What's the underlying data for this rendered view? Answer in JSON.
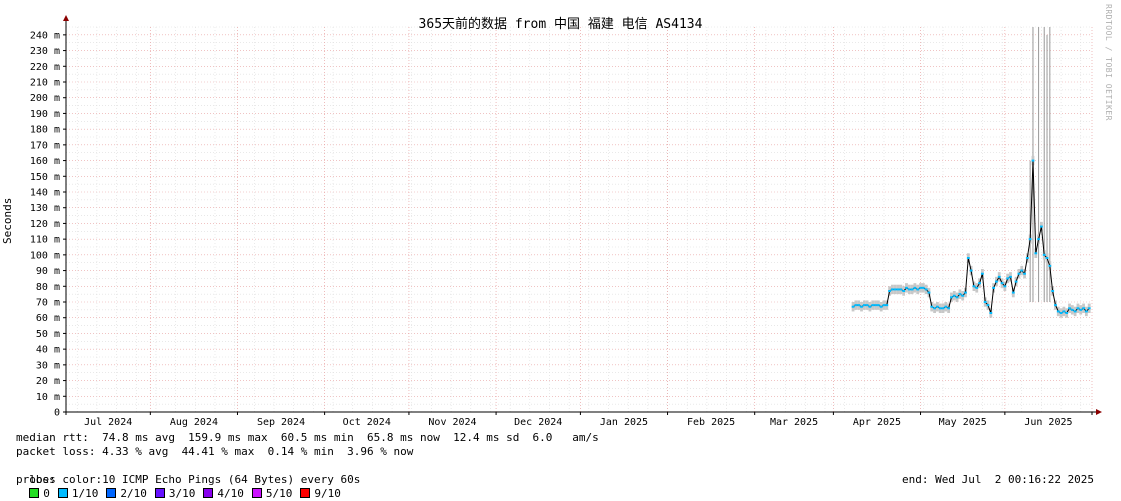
{
  "chart_data": {
    "type": "line",
    "title": "365天前的数据 from 中国 福建 电信 AS4134",
    "ylabel": "Seconds",
    "watermark": "RRDTOOL / TOBI OETIKER",
    "ylim": [
      0,
      245
    ],
    "y_ticks": [
      "0",
      "10 m",
      "20 m",
      "30 m",
      "40 m",
      "50 m",
      "60 m",
      "70 m",
      "80 m",
      "90 m",
      "100 m",
      "110 m",
      "120 m",
      "130 m",
      "140 m",
      "150 m",
      "160 m",
      "170 m",
      "180 m",
      "190 m",
      "200 m",
      "210 m",
      "220 m",
      "230 m",
      "240 m"
    ],
    "x_ticks": [
      "Jul 2024",
      "Aug 2024",
      "Sep 2024",
      "Oct 2024",
      "Nov 2024",
      "Dec 2024",
      "Jan 2025",
      "Feb 2025",
      "Mar 2025",
      "Apr 2025",
      "May 2025",
      "Jun 2025"
    ],
    "grid": true,
    "series": [
      {
        "name": "median rtt",
        "color": "#000000",
        "x": [
          280,
          281,
          282,
          283,
          284,
          285,
          286,
          287,
          288,
          289,
          290,
          291,
          292,
          293,
          294,
          295,
          296,
          297,
          298,
          299,
          300,
          301,
          302,
          303,
          304,
          305,
          306,
          307,
          308,
          309,
          310,
          311,
          312,
          313,
          314,
          315,
          316,
          317,
          318,
          319,
          320,
          321,
          322,
          323,
          324,
          325,
          326,
          327,
          328,
          329,
          330,
          331,
          332,
          333,
          334,
          335,
          336,
          337,
          338,
          339,
          340,
          341,
          342,
          343,
          344,
          345,
          346,
          347,
          348,
          349,
          350,
          351,
          352,
          353,
          354,
          355,
          356,
          357,
          358,
          359,
          360,
          361,
          362,
          363,
          364
        ],
        "values": [
          67,
          68,
          68,
          67,
          68,
          68,
          67,
          68,
          68,
          68,
          67,
          68,
          68,
          77,
          78,
          78,
          78,
          78,
          77,
          79,
          78,
          78,
          79,
          78,
          79,
          79,
          78,
          76,
          67,
          66,
          67,
          66,
          66,
          67,
          66,
          73,
          74,
          73,
          75,
          74,
          76,
          98,
          90,
          80,
          79,
          82,
          88,
          70,
          68,
          63,
          79,
          83,
          86,
          82,
          80,
          85,
          86,
          76,
          83,
          88,
          90,
          88,
          98,
          110,
          160,
          101,
          110,
          118,
          100,
          98,
          93,
          77,
          68,
          64,
          63,
          64,
          63,
          66,
          65,
          64,
          66,
          65,
          66,
          64,
          66
        ]
      }
    ],
    "spikes": [
      {
        "x": 343,
        "hi": 160
      },
      {
        "x": 344,
        "hi": 245
      },
      {
        "x": 346,
        "hi": 245
      },
      {
        "x": 348,
        "hi": 245
      },
      {
        "x": 349,
        "hi": 240
      },
      {
        "x": 350,
        "hi": 245
      }
    ]
  },
  "stats": {
    "median_rtt": "median rtt:  74.8 ms avg  159.9 ms max  60.5 ms min  65.8 ms now  12.4 ms sd  6.0   am/s",
    "packet_loss": "packet loss: 4.33 % avg  44.41 % max  0.14 % min  3.96 % now",
    "loss_color_label": "loss color:",
    "loss_colors": [
      {
        "label": "0",
        "color": "#22dd22"
      },
      {
        "label": "1/10",
        "color": "#00bbff"
      },
      {
        "label": "2/10",
        "color": "#0066ff"
      },
      {
        "label": "3/10",
        "color": "#6611ff"
      },
      {
        "label": "4/10",
        "color": "#8800ee"
      },
      {
        "label": "5/10",
        "color": "#cc11ff"
      },
      {
        "label": "9/10",
        "color": "#ff0000"
      }
    ],
    "probe": "probe:       10 ICMP Echo Pings (64 Bytes) every 60s",
    "end": "end: Wed Jul  2 00:16:22 2025"
  }
}
